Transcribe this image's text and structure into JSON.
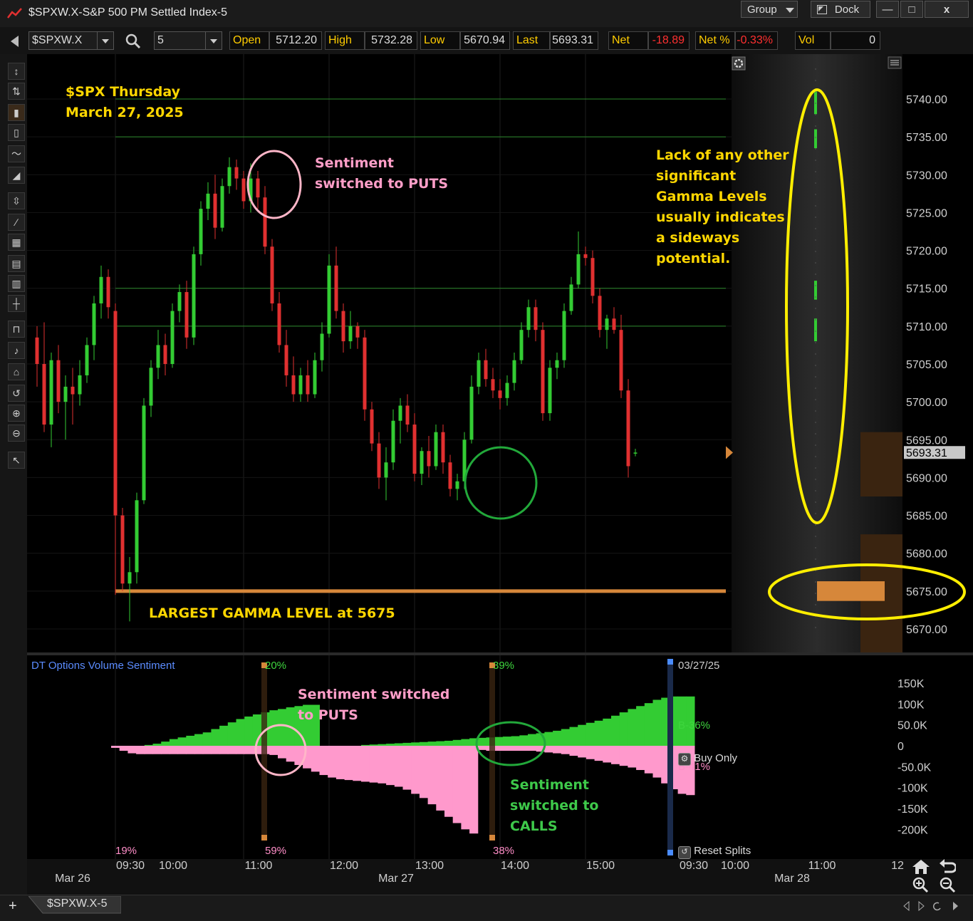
{
  "window": {
    "title": "$SPXW.X-S&P 500 PM Settled Index-5",
    "group_label": "Group",
    "dock_label": "Dock",
    "minimize": "—",
    "maximize": "□",
    "close": "x"
  },
  "toolbar": {
    "symbol": "$SPXW.X",
    "interval": "5",
    "quote": [
      {
        "label": "Open",
        "value": "5712.20",
        "neg": false
      },
      {
        "label": "High",
        "value": "5732.28",
        "neg": false
      },
      {
        "label": "Low",
        "value": "5670.94",
        "neg": false
      },
      {
        "label": "Last",
        "value": "5693.31",
        "neg": false
      },
      {
        "label": "Net",
        "value": "-18.89",
        "neg": true
      },
      {
        "label": "Net %",
        "value": "-0.33%",
        "neg": true
      },
      {
        "label": "Vol",
        "value": "0",
        "neg": false
      }
    ]
  },
  "tools": [
    "cursor-move-icon",
    "cursor-adjust-icon",
    "candlestick-icon",
    "bar-chart-icon",
    "line-chart-icon",
    "mountain-chart-icon",
    "fit-vertical-icon",
    "trendline-icon",
    "grid-icon",
    "table-icon",
    "data-table-icon",
    "crosshair-icon",
    "magnet-icon",
    "single-line-icon",
    "home-icon",
    "undo-icon",
    "zoom-in-icon",
    "zoom-out-icon",
    "pointer-icon"
  ],
  "annotations": {
    "title_line1": "$SPX Thursday",
    "title_line2": "March 27, 2025",
    "sentiment_puts_line1": "Sentiment",
    "sentiment_puts_line2": "switched to PUTS",
    "gamma_note": [
      "Lack of any other",
      "significant",
      "Gamma Levels",
      "usually indicates",
      "a sideways",
      "potential."
    ],
    "largest_gamma": "LARGEST GAMMA LEVEL at 5675",
    "lower_puts_line1": "Sentiment switched",
    "lower_puts_line2": "to PUTS",
    "lower_calls": [
      "Sentiment",
      "switched to",
      "CALLS"
    ]
  },
  "sentiment_panel": {
    "title": "DT Options Volume Sentiment",
    "date": "03/27/25",
    "buy_only": "Buy Only",
    "reset_splits": "Reset Splits",
    "b_pos": "B-36%",
    "b_neg": "B-41%",
    "marker_labels": [
      {
        "top": "20%",
        "bottom": "59%"
      },
      {
        "top": "39%",
        "bottom": "38%"
      }
    ],
    "left_bottom_pct": "19%",
    "y_ticks": [
      "150K",
      "100K",
      "50.0K",
      "0",
      "-50.0K",
      "-100K",
      "-150K",
      "-200K"
    ]
  },
  "time_axis": {
    "times": [
      "09:30",
      "10:00",
      "11:00",
      "12:00",
      "13:00",
      "14:00",
      "15:00",
      "09:30",
      "10:00",
      "11:00",
      "12"
    ],
    "dates": [
      "Mar 26",
      "Mar 27",
      "Mar 28"
    ]
  },
  "tab": {
    "label": "$SPXW.X-5",
    "add": "+"
  },
  "chart_data": [
    {
      "type": "candlestick",
      "title": "",
      "interval_minutes": 5,
      "ylim": [
        5665,
        5747
      ],
      "y_ticks": [
        "5740.00",
        "5735.00",
        "5730.00",
        "5725.00",
        "5720.00",
        "5715.00",
        "5710.00",
        "5705.00",
        "5700.00",
        "5695.00",
        "5690.00",
        "5685.00",
        "5680.00",
        "5675.00",
        "5670.00"
      ],
      "last_price": "5693.31",
      "gamma_levels": [
        5740,
        5735,
        5715,
        5710
      ],
      "largest_gamma_level": 5675,
      "session_start_x": 9.5,
      "candles": [
        [
          5708.5,
          5710.0,
          5702.0,
          5705.0
        ],
        [
          5705.0,
          5710.5,
          5696.0,
          5697.0
        ],
        [
          5697.0,
          5706.5,
          5694.0,
          5705.5
        ],
        [
          5705.5,
          5707.5,
          5698.5,
          5700.0
        ],
        [
          5700.0,
          5703.5,
          5695.0,
          5702.0
        ],
        [
          5702.0,
          5704.5,
          5697.0,
          5701.0
        ],
        [
          5701.0,
          5705.5,
          5699.5,
          5703.5
        ],
        [
          5703.5,
          5708.5,
          5702.5,
          5707.5
        ],
        [
          5707.5,
          5714.0,
          5705.5,
          5713.0
        ],
        [
          5713.0,
          5718.0,
          5711.0,
          5716.5
        ],
        [
          5716.5,
          5717.5,
          5711.0,
          5712.5
        ],
        [
          5712.0,
          5713.0,
          5674.5,
          5685.0
        ],
        [
          5685.0,
          5686.0,
          5675.0,
          5676.0
        ],
        [
          5676.0,
          5679.5,
          5671.0,
          5677.5
        ],
        [
          5677.5,
          5688.0,
          5676.0,
          5687.0
        ],
        [
          5687.0,
          5700.5,
          5686.5,
          5699.5
        ],
        [
          5699.5,
          5705.5,
          5698.0,
          5704.5
        ],
        [
          5704.5,
          5709.5,
          5703.0,
          5707.5
        ],
        [
          5707.5,
          5709.0,
          5703.5,
          5705.0
        ],
        [
          5705.0,
          5713.0,
          5704.5,
          5712.0
        ],
        [
          5712.0,
          5715.5,
          5710.5,
          5714.5
        ],
        [
          5714.5,
          5716.0,
          5707.0,
          5708.5
        ],
        [
          5708.5,
          5720.5,
          5707.5,
          5719.5
        ],
        [
          5719.5,
          5726.5,
          5718.0,
          5725.5
        ],
        [
          5725.5,
          5729.0,
          5724.0,
          5727.5
        ],
        [
          5727.5,
          5730.0,
          5721.5,
          5723.0
        ],
        [
          5723.0,
          5729.5,
          5722.5,
          5728.5
        ],
        [
          5728.5,
          5732.3,
          5727.5,
          5731.0
        ],
        [
          5731.0,
          5732.0,
          5728.0,
          5729.5
        ],
        [
          5729.5,
          5730.5,
          5725.5,
          5726.5
        ],
        [
          5726.5,
          5731.5,
          5725.0,
          5729.5
        ],
        [
          5729.5,
          5730.5,
          5725.5,
          5727.0
        ],
        [
          5727.0,
          5728.5,
          5719.5,
          5720.5
        ],
        [
          5720.5,
          5721.5,
          5712.0,
          5713.0
        ],
        [
          5713.0,
          5714.5,
          5706.5,
          5707.5
        ],
        [
          5707.5,
          5709.5,
          5702.0,
          5703.5
        ],
        [
          5703.5,
          5706.0,
          5700.0,
          5701.0
        ],
        [
          5701.0,
          5704.5,
          5700.0,
          5703.5
        ],
        [
          5703.5,
          5705.5,
          5700.0,
          5701.0
        ],
        [
          5701.0,
          5706.5,
          5700.5,
          5705.5
        ],
        [
          5705.5,
          5710.5,
          5704.0,
          5709.0
        ],
        [
          5709.0,
          5719.5,
          5708.5,
          5718.0
        ],
        [
          5718.0,
          5720.5,
          5711.0,
          5712.0
        ],
        [
          5712.0,
          5713.0,
          5706.5,
          5708.0
        ],
        [
          5708.0,
          5712.0,
          5707.0,
          5710.0
        ],
        [
          5710.0,
          5710.5,
          5707.0,
          5708.5
        ],
        [
          5708.5,
          5709.5,
          5697.5,
          5699.0
        ],
        [
          5699.0,
          5700.0,
          5693.5,
          5694.5
        ],
        [
          5694.5,
          5696.0,
          5688.5,
          5690.0
        ],
        [
          5690.0,
          5694.0,
          5687.0,
          5692.0
        ],
        [
          5692.0,
          5699.0,
          5691.0,
          5697.5
        ],
        [
          5697.5,
          5700.5,
          5694.5,
          5699.5
        ],
        [
          5699.5,
          5701.0,
          5696.0,
          5697.0
        ],
        [
          5697.0,
          5698.5,
          5689.5,
          5690.5
        ],
        [
          5690.5,
          5694.0,
          5689.0,
          5693.5
        ],
        [
          5693.5,
          5695.5,
          5690.0,
          5691.5
        ],
        [
          5691.5,
          5697.0,
          5691.0,
          5696.0
        ],
        [
          5696.0,
          5697.0,
          5690.5,
          5692.0
        ],
        [
          5692.0,
          5693.0,
          5687.5,
          5688.5
        ],
        [
          5688.5,
          5690.5,
          5687.0,
          5689.5
        ],
        [
          5689.5,
          5696.0,
          5688.5,
          5695.0
        ],
        [
          5695.0,
          5703.5,
          5694.5,
          5702.0
        ],
        [
          5702.0,
          5706.5,
          5701.0,
          5705.5
        ],
        [
          5705.5,
          5707.0,
          5702.0,
          5703.0
        ],
        [
          5703.0,
          5704.5,
          5700.5,
          5701.5
        ],
        [
          5701.5,
          5703.0,
          5699.0,
          5700.5
        ],
        [
          5700.5,
          5703.5,
          5699.5,
          5702.5
        ],
        [
          5702.5,
          5706.5,
          5701.5,
          5705.5
        ],
        [
          5705.5,
          5710.5,
          5705.0,
          5709.5
        ],
        [
          5709.5,
          5713.5,
          5708.5,
          5712.5
        ],
        [
          5712.5,
          5713.5,
          5708.0,
          5709.5
        ],
        [
          5709.5,
          5710.5,
          5697.5,
          5698.5
        ],
        [
          5698.5,
          5705.5,
          5697.5,
          5704.5
        ],
        [
          5704.5,
          5706.5,
          5703.0,
          5705.5
        ],
        [
          5705.5,
          5713.0,
          5704.5,
          5712.0
        ],
        [
          5712.0,
          5716.5,
          5711.5,
          5715.5
        ],
        [
          5715.5,
          5722.5,
          5715.0,
          5719.5
        ],
        [
          5719.5,
          5720.5,
          5718.0,
          5719.0
        ],
        [
          5719.0,
          5720.0,
          5713.0,
          5714.0
        ],
        [
          5714.0,
          5715.0,
          5708.5,
          5709.5
        ],
        [
          5709.5,
          5711.5,
          5707.0,
          5711.0
        ],
        [
          5711.0,
          5712.5,
          5709.0,
          5709.5
        ],
        [
          5709.5,
          5711.5,
          5700.5,
          5701.5
        ],
        [
          5701.5,
          5703.0,
          5690.0,
          5691.5
        ],
        [
          5693.2,
          5693.8,
          5692.8,
          5693.3
        ]
      ]
    },
    {
      "type": "area",
      "title": "DT Options Volume Sentiment",
      "ylim": [
        -215000,
        165000
      ],
      "series": [
        {
          "name": "B-36%",
          "values": [
            0,
            0,
            0,
            0,
            2000,
            5000,
            10000,
            16000,
            20000,
            24000,
            28000,
            32000,
            40000,
            48000,
            56000,
            64000,
            70000,
            75000,
            80000,
            85000,
            88000,
            92000,
            95000,
            98000,
            98000,
            0,
            0,
            0,
            0,
            0,
            2000,
            3000,
            4000,
            5000,
            6000,
            7000,
            8000,
            9000,
            10000,
            11000,
            12000,
            14000,
            16000,
            18000,
            19000,
            20000,
            21000,
            22000,
            23000,
            25000,
            28000,
            30000,
            33000,
            36000,
            40000,
            45000,
            50000,
            55000,
            60000,
            65000,
            72000,
            80000,
            88000,
            95000,
            102000,
            110000,
            115000,
            118000,
            118000,
            118000
          ]
        },
        {
          "name": "B-41%",
          "values": [
            -5000,
            -12000,
            -18000,
            -20000,
            -20000,
            -20000,
            -20000,
            -20000,
            -20000,
            -20000,
            -20000,
            -20000,
            -20000,
            -20000,
            -20000,
            -20000,
            -20000,
            -20000,
            -20000,
            -22000,
            -30000,
            -38000,
            -46000,
            -54000,
            -62000,
            -70000,
            -76000,
            -80000,
            -82000,
            -84000,
            -86000,
            -88000,
            -90000,
            -94000,
            -98000,
            -105000,
            -115000,
            -125000,
            -140000,
            -155000,
            -170000,
            -185000,
            -200000,
            -210000,
            -10000,
            -12000,
            -12000,
            -12000,
            -12000,
            -12000,
            -12000,
            -14000,
            -16000,
            -18000,
            -20000,
            -24000,
            -28000,
            -32000,
            -36000,
            -40000,
            -44000,
            -48000,
            -52000,
            -58000,
            -66000,
            -76000,
            -90000,
            -104000,
            -115000,
            -118000
          ]
        }
      ]
    }
  ]
}
